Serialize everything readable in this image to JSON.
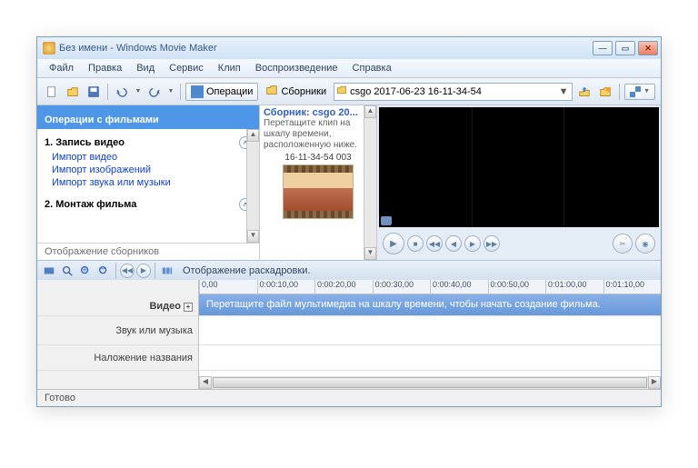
{
  "window": {
    "title": "Без имени - Windows Movie Maker"
  },
  "menu": {
    "file": "Файл",
    "edit": "Правка",
    "view": "Вид",
    "tools": "Сервис",
    "clip": "Клип",
    "play": "Воспроизведение",
    "help": "Справка"
  },
  "toolbar": {
    "operations": "Операции",
    "collections": "Сборники",
    "combo_value": "csgo 2017-06-23 16-11-34-54"
  },
  "tasks": {
    "header": "Операции с фильмами",
    "s1_title": "1. Запись видео",
    "link1": "Импорт видео",
    "link2": "Импорт изображений",
    "link3": "Импорт звука или музыки",
    "s2_title": "2. Монтаж фильма",
    "footer": "Отображение сборников"
  },
  "collection": {
    "header": "Сборник: csgo 20...",
    "hint": "Перетащите клип на шкалу времени, расположенную ниже.",
    "clip_name": "16-11-34-54 003"
  },
  "storyboard_label": "Отображение раскадровки.",
  "ruler": [
    "0,00",
    "0:00:10,00",
    "0:00:20,00",
    "0:00:30,00",
    "0:00:40,00",
    "0:00:50,00",
    "0:01:00,00",
    "0:01:10,00"
  ],
  "tracks": {
    "video": "Видео",
    "video_hint": "Перетащите файл мультимедиа на шкалу времени, чтобы начать создание фильма.",
    "audio": "Звук или музыка",
    "title": "Наложение названия"
  },
  "status": "Готово"
}
